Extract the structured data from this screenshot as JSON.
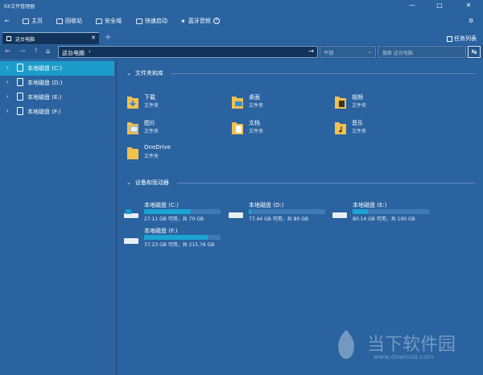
{
  "window": {
    "title": "RX文件管理器"
  },
  "navbar": {
    "items": [
      {
        "label": "主页"
      },
      {
        "label": "回收站"
      },
      {
        "label": "安全域"
      },
      {
        "label": "快速启动"
      },
      {
        "label": "蓝牙音频"
      }
    ]
  },
  "tabs": [
    {
      "label": "这台电脑"
    }
  ],
  "taskbar_label": "任务列表",
  "address": {
    "path": "这台电脑",
    "view_placeholder": "平铺",
    "search_placeholder": "搜索 这台电脑"
  },
  "sidebar": {
    "items": [
      {
        "label": "本地磁盘 (C:)"
      },
      {
        "label": "本地磁盘 (D:)"
      },
      {
        "label": "本地磁盘 (E:)"
      },
      {
        "label": "本地磁盘 (F:)"
      }
    ]
  },
  "sections": {
    "folders_title": "文件夹和库",
    "drives_title": "设备和驱动器"
  },
  "folders": [
    {
      "name": "下载",
      "type": "文件夹"
    },
    {
      "name": "桌面",
      "type": "文件夹"
    },
    {
      "name": "视频",
      "type": "文件夹"
    },
    {
      "name": "图片",
      "type": "文件夹"
    },
    {
      "name": "文档",
      "type": "文件夹"
    },
    {
      "name": "音乐",
      "type": "文件夹"
    },
    {
      "name": "OneDrive",
      "type": "文件夹"
    }
  ],
  "drives": [
    {
      "name": "本地磁盘 (C:)",
      "info": "27.11 GB 可用，共 70 GB",
      "used_fraction": 0.61
    },
    {
      "name": "本地磁盘 (D:)",
      "info": "77.44 GB 可用，共 80 GB",
      "used_fraction": 0.03
    },
    {
      "name": "本地磁盘 (E:)",
      "info": "80.14 GB 可用，共 100 GB",
      "used_fraction": 0.2
    },
    {
      "name": "本地磁盘 (F:)",
      "info": "37.23 GB 可用，共 215.76 GB",
      "used_fraction": 0.83
    }
  ],
  "watermark": {
    "text": "当下软件园",
    "url": "www.downxia.com"
  },
  "colors": {
    "background": "#2a63a0",
    "selected": "#1d9ccb",
    "bar_fill": "#1ba3d2",
    "folder": "#f2c14e"
  }
}
